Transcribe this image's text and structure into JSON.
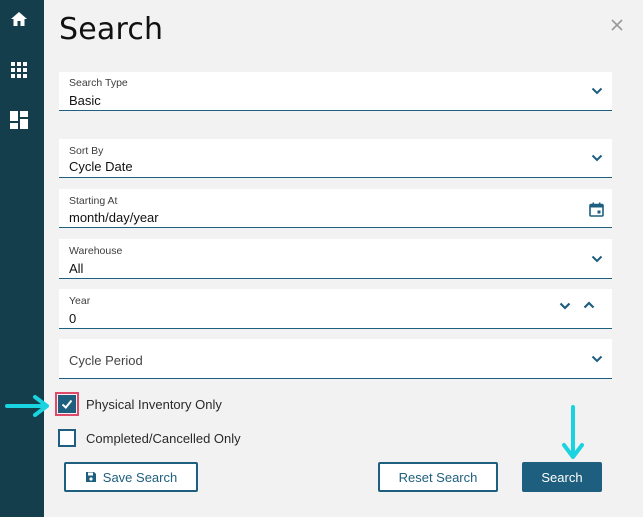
{
  "rail": {
    "icons": [
      "home-icon",
      "apps-grid-icon",
      "dashboard-icon"
    ]
  },
  "panel": {
    "title": "Search",
    "close_icon": "close-icon"
  },
  "fields": {
    "search_type": {
      "label": "Search Type",
      "value": "Basic"
    },
    "sort_by": {
      "label": "Sort By",
      "value": "Cycle Date"
    },
    "starting_at": {
      "label": "Starting At",
      "value": "month/day/year"
    },
    "warehouse": {
      "label": "Warehouse",
      "value": "All"
    },
    "year": {
      "label": "Year",
      "value": "0"
    },
    "cycle_period": {
      "placeholder": "Cycle Period"
    }
  },
  "checkboxes": {
    "physical_inventory": {
      "label": "Physical Inventory Only",
      "checked": true
    },
    "completed_cancelled": {
      "label": "Completed/Cancelled Only",
      "checked": false
    }
  },
  "buttons": {
    "save_search": "Save Search",
    "reset_search": "Reset Search",
    "search": "Search"
  },
  "colors": {
    "rail_bg": "#143e4b",
    "accent": "#1e5e7e",
    "annotation": "#19d3e0"
  }
}
